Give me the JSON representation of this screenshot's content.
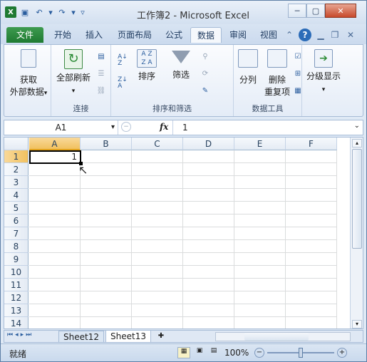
{
  "window": {
    "title": "工作簿2 - Microsoft Excel",
    "controls": [
      "─",
      "▢",
      "✕"
    ]
  },
  "tabs": {
    "file": "文件",
    "items": [
      "开始",
      "插入",
      "页面布局",
      "公式",
      "数据",
      "审阅",
      "视图"
    ],
    "active": "数据"
  },
  "ribbon": {
    "get_external": [
      "获取",
      "外部数据"
    ],
    "connections": {
      "refresh_all": "全部刷新",
      "label": "连接"
    },
    "sort_filter": {
      "sort": "排序",
      "filter": "筛选",
      "label": "排序和筛选"
    },
    "data_tools": {
      "text_to_columns": "分列",
      "remove_dup": [
        "删除",
        "重复项"
      ],
      "label": "数据工具"
    },
    "outline": {
      "label": "分级显示"
    }
  },
  "formula_bar": {
    "name_box": "A1",
    "fx": "fx",
    "value": "1"
  },
  "grid": {
    "columns": [
      "A",
      "B",
      "C",
      "D",
      "E",
      "F"
    ],
    "rows": [
      "1",
      "2",
      "3",
      "4",
      "5",
      "6",
      "7",
      "8",
      "9",
      "10",
      "11",
      "12",
      "13",
      "14"
    ],
    "a1_value": "1"
  },
  "sheets": {
    "tabs": [
      "Sheet12",
      "Sheet13"
    ],
    "active": "Sheet13"
  },
  "status": {
    "mode": "就绪",
    "zoom": "100%"
  }
}
